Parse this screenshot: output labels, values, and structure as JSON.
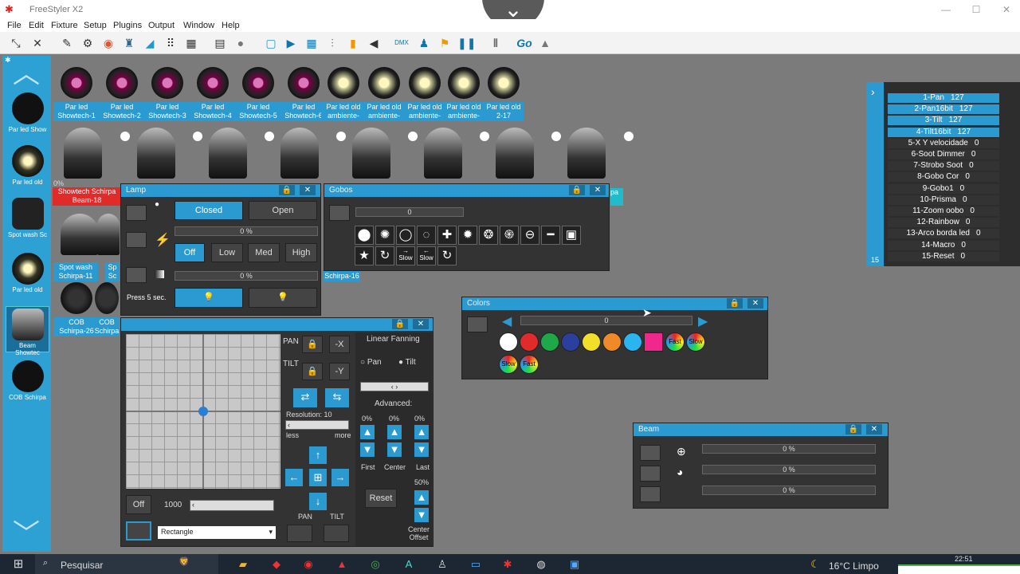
{
  "app": {
    "title": "FreeStyler X2"
  },
  "menu": [
    "File",
    "Edit",
    "Fixture",
    "Setup",
    "Plugins",
    "Output",
    "Window",
    "Help"
  ],
  "sidebar": [
    {
      "label": "Par led Show"
    },
    {
      "label": "Par led old"
    },
    {
      "label": "Spot wash Sc"
    },
    {
      "label": "Par led old"
    },
    {
      "label": "Beam Showtec"
    },
    {
      "label": "COB Schirpa"
    }
  ],
  "fixtures": [
    {
      "line1": "Par led",
      "line2": "Showtech-1"
    },
    {
      "line1": "Par led",
      "line2": "Showtech-2"
    },
    {
      "line1": "Par led",
      "line2": "Showtech-3"
    },
    {
      "line1": "Par led",
      "line2": "Showtech-4"
    },
    {
      "line1": "Par led",
      "line2": "Showtech-5"
    },
    {
      "line1": "Par led",
      "line2": "Showtech-6"
    },
    {
      "line1": "Par led old",
      "line2": "ambiente-"
    },
    {
      "line1": "Par led old",
      "line2": "ambiente-"
    },
    {
      "line1": "Par led old",
      "line2": "ambiente-"
    },
    {
      "line1": "Par led old",
      "line2": "ambiente-"
    },
    {
      "line1": "Par led old",
      "line2": "2-17"
    }
  ],
  "lower_fixtures": {
    "red_label_1": "Showtech Schirpa",
    "red_label_2": "Beam-18",
    "spot_1": "Spot wash",
    "spot_2": "Schirpa-11",
    "spot_3": "Sp",
    "spot_4": "Sc",
    "cob_1": "COB",
    "cob_2": "Schirpa-26",
    "cob_3": "COB",
    "cob_4": "Schirpa",
    "gobos_under": "Schirpa-16",
    "pa": "pa",
    "pct": "0%"
  },
  "lamp": {
    "title": "Lamp",
    "closed": "Closed",
    "open": "Open",
    "pct1": "0 %",
    "pct2": "0 %",
    "off": "Off",
    "low": "Low",
    "med": "Med",
    "high": "High",
    "press": "Press 5 sec."
  },
  "gobos": {
    "title": "Gobos",
    "value": "0",
    "slow": "Slow"
  },
  "colors": {
    "title": "Colors",
    "value": "0",
    "fast": "Fast",
    "slow": "Slow",
    "swatches": [
      "#ffffff",
      "#e02b2b",
      "#1ea84a",
      "#2b3f9c",
      "#f2e028",
      "#f08a28",
      "#2ab4f0",
      "#f0288c"
    ]
  },
  "pantilt": {
    "pan": "PAN",
    "tilt": "TILT",
    "minus_x": "-X",
    "minus_y": "-Y",
    "resolution": "Resolution: 10",
    "less": "less",
    "more": "more",
    "off": "Off",
    "speed": "1000",
    "shape": "Rectangle",
    "fanning": "Linear Fanning",
    "fan_pan": "Pan",
    "fan_tilt": "Tilt",
    "advanced": "Advanced:",
    "p1": "0%",
    "p2": "0%",
    "p3": "0%",
    "first": "First",
    "center": "Center",
    "last": "Last",
    "reset": "Reset",
    "pct50": "50%",
    "center_offset_1": "Center",
    "center_offset_2": "Offset",
    "pan_btn": "PAN",
    "tilt_btn": "TILT"
  },
  "beam": {
    "title": "Beam",
    "v1": "0 %",
    "v2": "0 %",
    "v3": "0 %"
  },
  "channels": {
    "count": "15",
    "rows": [
      {
        "t": "1-Pan",
        "v": "127",
        "hl": true
      },
      {
        "t": "2-Pan16bit",
        "v": "127",
        "hl": true
      },
      {
        "t": "3-Tilt",
        "v": "127",
        "hl": true
      },
      {
        "t": "4-Tilt16bit",
        "v": "127",
        "hl": true
      },
      {
        "t": "5-X Y velocidade",
        "v": "0"
      },
      {
        "t": "6-Soot Dimmer",
        "v": "0"
      },
      {
        "t": "7-Strobo Soot",
        "v": "0"
      },
      {
        "t": "8-Gobo Cor",
        "v": "0"
      },
      {
        "t": "9-Gobo1",
        "v": "0"
      },
      {
        "t": "10-Prisma",
        "v": "0"
      },
      {
        "t": "11-Zoom oobo",
        "v": "0"
      },
      {
        "t": "12-Rainbow",
        "v": "0"
      },
      {
        "t": "13-Arco borda led",
        "v": "0"
      },
      {
        "t": "14-Macro",
        "v": "0"
      },
      {
        "t": "15-Reset",
        "v": "0"
      }
    ]
  },
  "taskbar": {
    "search": "Pesquisar",
    "weather": "16°C Limpo",
    "time": "22:51"
  },
  "icons": {
    "go": "Go",
    "dmx": "DMX"
  }
}
